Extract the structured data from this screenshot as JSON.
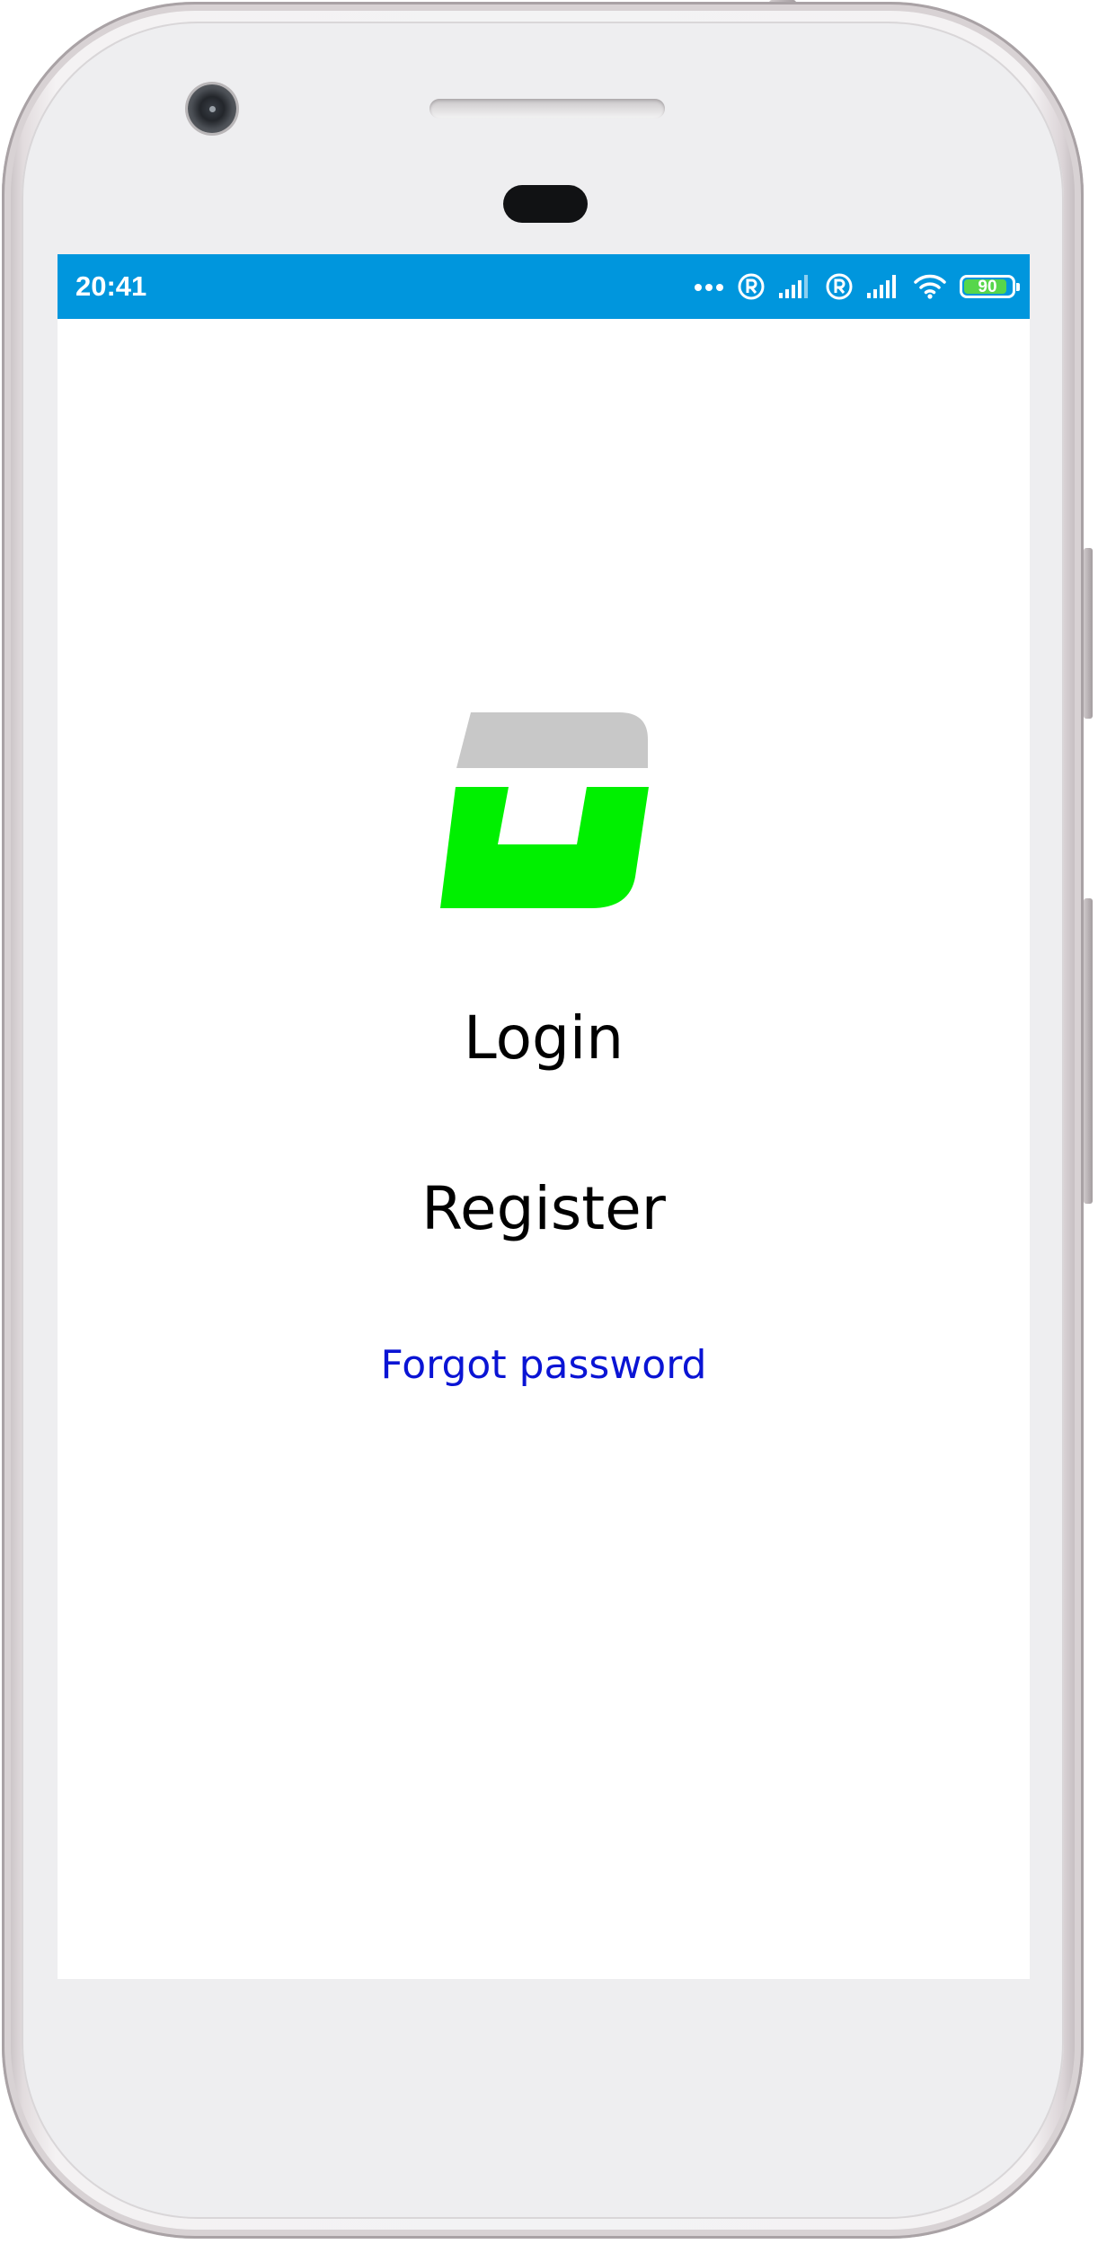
{
  "status_bar": {
    "time": "20:41",
    "background_color": "#0096dd",
    "icons": [
      "more-dots-icon",
      "roaming-r-icon",
      "signal-icon",
      "roaming-r-icon",
      "signal-icon",
      "wifi-icon",
      "battery-icon"
    ],
    "battery_level": "90",
    "battery_fraction": 0.9
  },
  "app": {
    "logo_icon": "app-logo-icon",
    "logo_colors": {
      "top": "#c8c8c8",
      "bottom": "#00f000"
    },
    "menu": {
      "login_label": "Login",
      "register_label": "Register",
      "forgot_password_label": "Forgot password"
    },
    "link_color": "#0a14d4"
  }
}
